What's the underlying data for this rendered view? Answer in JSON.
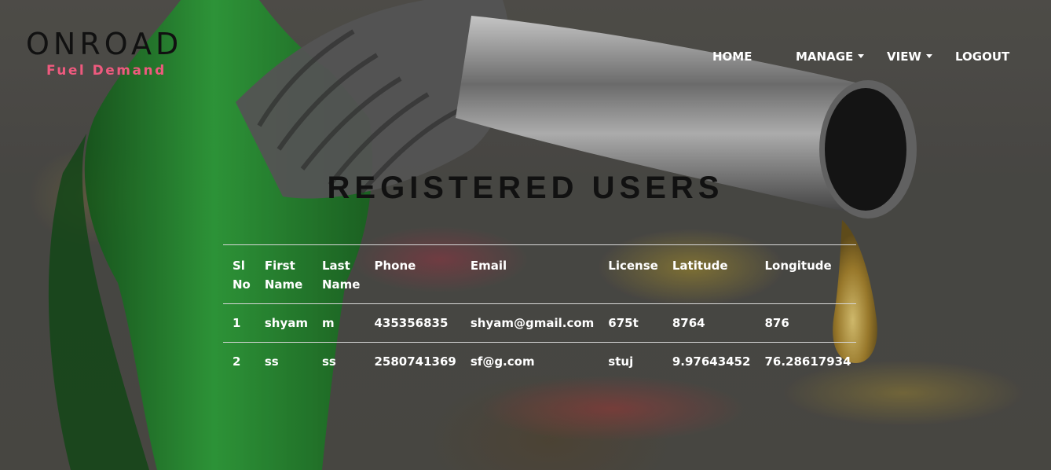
{
  "brand": {
    "title": "ONROAD",
    "subtitle": "Fuel Demand"
  },
  "nav": {
    "items": [
      {
        "label": "HOME",
        "dropdown": false
      },
      {
        "label": "MANAGE",
        "dropdown": true
      },
      {
        "label": "VIEW",
        "dropdown": true
      },
      {
        "label": "LOGOUT",
        "dropdown": false
      }
    ]
  },
  "page": {
    "title": "REGISTERED USERS"
  },
  "table": {
    "headers": [
      [
        "Sl",
        "No"
      ],
      [
        "First",
        "Name"
      ],
      [
        "Last",
        "Name"
      ],
      [
        "Phone",
        ""
      ],
      [
        "Email",
        ""
      ],
      [
        "License",
        ""
      ],
      [
        "Latitude",
        ""
      ],
      [
        "Longitude",
        ""
      ]
    ],
    "rows": [
      [
        "1",
        "shyam",
        "m",
        "435356835",
        "shyam@gmail.com",
        "675t",
        "8764",
        "876"
      ],
      [
        "2",
        "ss",
        "ss",
        "2580741369",
        "sf@g.com",
        "stuj",
        "9.97643452",
        "76.28617934"
      ]
    ]
  },
  "colors": {
    "brand_sub": "#ee5a7e",
    "nav_text": "#ffffff",
    "title": "#111111"
  }
}
